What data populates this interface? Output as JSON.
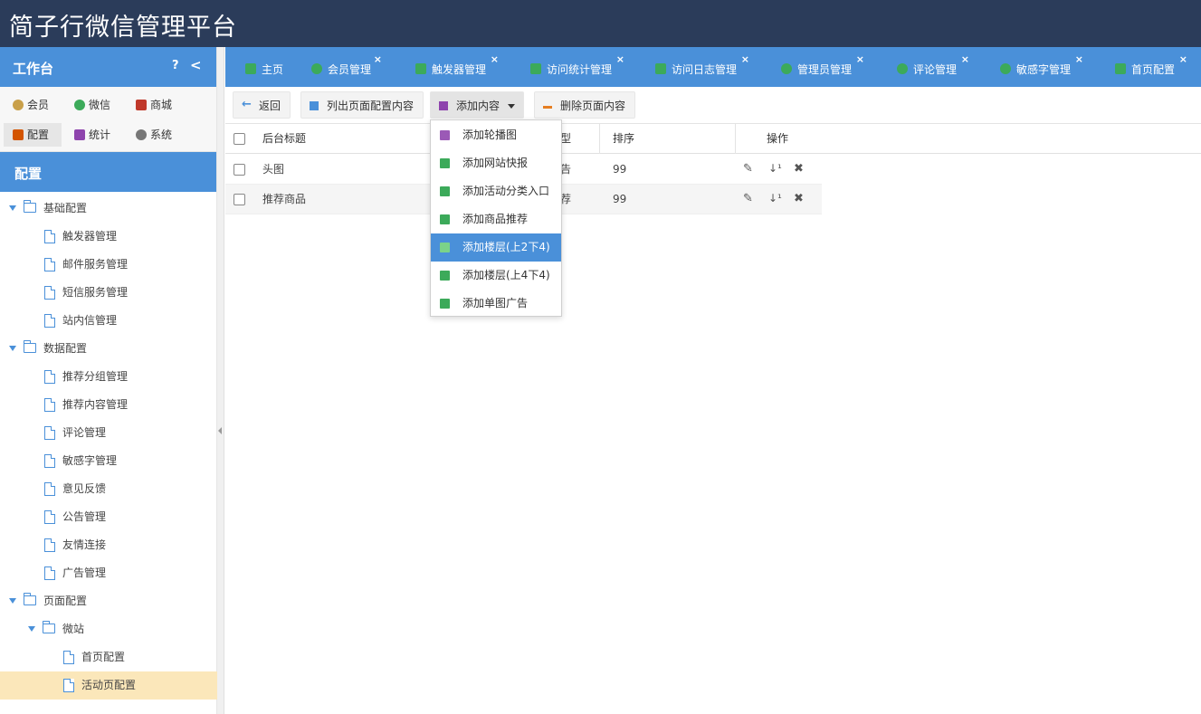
{
  "app": {
    "title": "简子行微信管理平台"
  },
  "sidebar": {
    "header": "工作台",
    "help": "?",
    "collapse": "<",
    "modules": [
      {
        "label": "会员",
        "icon": "member-icon",
        "color": "#c9a04a"
      },
      {
        "label": "微信",
        "icon": "wechat-icon",
        "color": "#3caa5a"
      },
      {
        "label": "商城",
        "icon": "shop-icon",
        "color": "#c0392b"
      },
      {
        "label": "配置",
        "icon": "config-icon",
        "color": "#d35400"
      },
      {
        "label": "统计",
        "icon": "stats-icon",
        "color": "#8e44ad"
      },
      {
        "label": "系统",
        "icon": "system-icon",
        "color": "#555555"
      }
    ],
    "section": "配置",
    "tree": [
      {
        "label": "基础配置"
      },
      {
        "label": "触发器管理"
      },
      {
        "label": "邮件服务管理"
      },
      {
        "label": "短信服务管理"
      },
      {
        "label": "站内信管理"
      },
      {
        "label": "数据配置"
      },
      {
        "label": "推荐分组管理"
      },
      {
        "label": "推荐内容管理"
      },
      {
        "label": "评论管理"
      },
      {
        "label": "敏感字管理"
      },
      {
        "label": "意见反馈"
      },
      {
        "label": "公告管理"
      },
      {
        "label": "友情连接"
      },
      {
        "label": "广告管理"
      },
      {
        "label": "页面配置"
      },
      {
        "label": "微站"
      },
      {
        "label": "首页配置"
      },
      {
        "label": "活动页配置"
      }
    ]
  },
  "tabs": [
    {
      "label": "主页",
      "color": "#3caa5a"
    },
    {
      "label": "会员管理",
      "color": "#3caa5a"
    },
    {
      "label": "触发器管理",
      "color": "#3caa5a"
    },
    {
      "label": "访问统计管理",
      "color": "#3caa5a"
    },
    {
      "label": "访问日志管理",
      "color": "#3caa5a"
    },
    {
      "label": "管理员管理",
      "color": "#3caa5a"
    },
    {
      "label": "评论管理",
      "color": "#3caa5a"
    },
    {
      "label": "敏感字管理",
      "color": "#3caa5a"
    },
    {
      "label": "首页配置",
      "color": "#3caa5a"
    }
  ],
  "tab_close": "×",
  "toolbar": {
    "back": "返回",
    "list": "列出页面配置内容",
    "add": "添加内容",
    "delete": "删除页面内容"
  },
  "grid": {
    "headers": {
      "title": "后台标题",
      "type": "型",
      "sort": "排序",
      "ops": "操作"
    },
    "rows": [
      {
        "title": "头图",
        "type": "告",
        "sort": "99"
      },
      {
        "title": "推荐商品",
        "type": "荐",
        "sort": "99"
      }
    ]
  },
  "menu": {
    "items": [
      {
        "label": "添加轮播图",
        "color": "#9b59b6"
      },
      {
        "label": "添加网站快报",
        "color": "#3caa5a"
      },
      {
        "label": "添加活动分类入口",
        "color": "#3caa5a"
      },
      {
        "label": "添加商品推荐",
        "color": "#3caa5a"
      },
      {
        "label": "添加楼层(上2下4)",
        "color": "#3caa5a"
      },
      {
        "label": "添加楼层(上4下4)",
        "color": "#3caa5a"
      },
      {
        "label": "添加单图广告",
        "color": "#3caa5a"
      }
    ]
  }
}
